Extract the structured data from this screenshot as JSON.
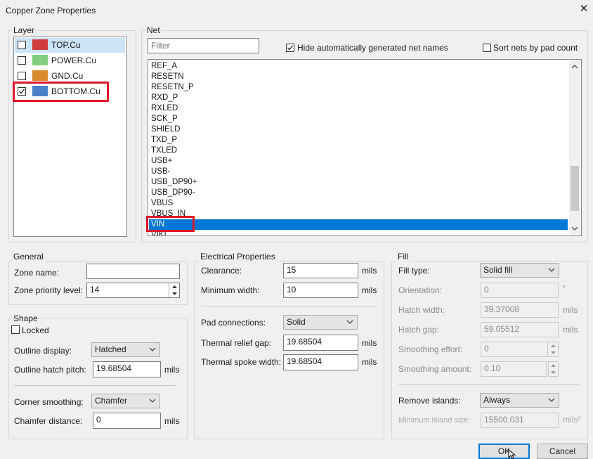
{
  "window": {
    "title": "Copper Zone Properties"
  },
  "layer": {
    "label": "Layer",
    "items": [
      {
        "name": "TOP.Cu",
        "color": "#d03c3c",
        "checked": false,
        "highlighted": true
      },
      {
        "name": "POWER.Cu",
        "color": "#7fcf7f",
        "checked": false,
        "highlighted": false
      },
      {
        "name": "GND.Cu",
        "color": "#d98b2e",
        "checked": false,
        "highlighted": false
      },
      {
        "name": "BOTTOM.Cu",
        "color": "#4a7fc9",
        "checked": true,
        "highlighted": false
      }
    ]
  },
  "net": {
    "label": "Net",
    "filter_placeholder": "Filter",
    "hide_auto_label": "Hide automatically generated net names",
    "hide_auto_checked": true,
    "sort_label": "Sort nets by pad count",
    "sort_checked": false,
    "items": [
      "REF_A",
      "RESETN",
      "RESETN_P",
      "RXD_P",
      "RXLED",
      "SCK_P",
      "SHIELD",
      "TXD_P",
      "TXLED",
      "USB+",
      "USB-",
      "USB_DP90+",
      "USB_DP90-",
      "VBUS",
      "VBUS_IN",
      "VIN",
      "VIKI"
    ],
    "selected": "VIN"
  },
  "general": {
    "label": "General",
    "zone_name_label": "Zone name:",
    "zone_name_value": "",
    "priority_label": "Zone priority level:",
    "priority_value": "14"
  },
  "shape": {
    "label": "Shape",
    "locked_label": "Locked",
    "locked_checked": false,
    "outline_display_label": "Outline display:",
    "outline_display_value": "Hatched",
    "hatch_pitch_label": "Outline hatch pitch:",
    "hatch_pitch_value": "19.68504",
    "hatch_pitch_unit": "mils",
    "corner_smoothing_label": "Corner smoothing:",
    "corner_smoothing_value": "Chamfer",
    "chamfer_distance_label": "Chamfer distance:",
    "chamfer_distance_value": "0",
    "chamfer_distance_unit": "mils"
  },
  "electrical": {
    "label": "Electrical Properties",
    "clearance_label": "Clearance:",
    "clearance_value": "15",
    "clearance_unit": "mils",
    "min_width_label": "Minimum width:",
    "min_width_value": "10",
    "min_width_unit": "mils",
    "pad_conn_label": "Pad connections:",
    "pad_conn_value": "Solid",
    "relief_gap_label": "Thermal relief gap:",
    "relief_gap_value": "19.68504",
    "relief_gap_unit": "mils",
    "spoke_width_label": "Thermal spoke width:",
    "spoke_width_value": "19.68504",
    "spoke_width_unit": "mils"
  },
  "fill": {
    "label": "Fill",
    "fill_type_label": "Fill type:",
    "fill_type_value": "Solid fill",
    "orientation_label": "Orientation:",
    "orientation_value": "0",
    "orientation_unit": "°",
    "hatch_width_label": "Hatch width:",
    "hatch_width_value": "39.37008",
    "hatch_width_unit": "mils",
    "hatch_gap_label": "Hatch gap:",
    "hatch_gap_value": "59.05512",
    "hatch_gap_unit": "mils",
    "smoothing_effort_label": "Smoothing effort:",
    "smoothing_effort_value": "0",
    "smoothing_amount_label": "Smoothing amount:",
    "smoothing_amount_value": "0.10",
    "remove_islands_label": "Remove islands:",
    "remove_islands_value": "Always",
    "min_island_label": "Minimum island size:",
    "min_island_value": "15500.031",
    "min_island_unit": "mils²"
  },
  "buttons": {
    "ok": "OK",
    "cancel": "Cancel"
  },
  "annotations": {
    "highlight_color": "#e0162a"
  }
}
